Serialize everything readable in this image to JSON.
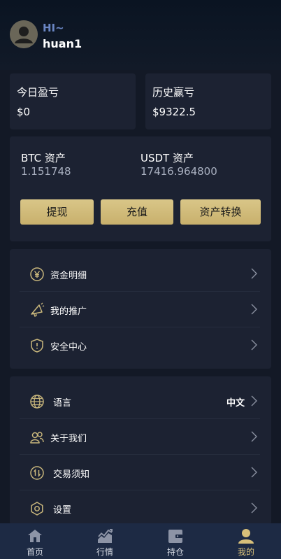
{
  "user": {
    "greeting": "HI~",
    "username": "huan1"
  },
  "pnl": {
    "today": {
      "label": "今日盈亏",
      "value": "$0"
    },
    "history": {
      "label": "历史赢亏",
      "value": "$9322.5"
    }
  },
  "assets": {
    "btc": {
      "label": "BTC 资产",
      "value": "1.151748"
    },
    "usdt": {
      "label": "USDT 资产",
      "value": "17416.964800"
    },
    "buttons": {
      "withdraw": "提现",
      "deposit": "充值",
      "transfer": "资产转换"
    }
  },
  "menu1": [
    {
      "label": "资金明细",
      "icon": "yen-coin-icon"
    },
    {
      "label": "我的推广",
      "icon": "megaphone-icon"
    },
    {
      "label": "安全中心",
      "icon": "shield-icon"
    }
  ],
  "menu2": [
    {
      "label": "语言",
      "icon": "globe-icon",
      "value": "中文"
    },
    {
      "label": "关于我们",
      "icon": "users-icon"
    },
    {
      "label": "交易须知",
      "icon": "exchange-icon"
    },
    {
      "label": "设置",
      "icon": "gear-icon"
    }
  ],
  "tabs": [
    {
      "label": "首页",
      "icon": "home-icon"
    },
    {
      "label": "行情",
      "icon": "chart-icon"
    },
    {
      "label": "持仓",
      "icon": "wallet-icon"
    },
    {
      "label": "我的",
      "icon": "user-icon",
      "active": true
    }
  ],
  "colors": {
    "accent": "#d8c07a",
    "background": "#131926",
    "card": "#1c2232",
    "tabbar": "#1d2a44"
  }
}
